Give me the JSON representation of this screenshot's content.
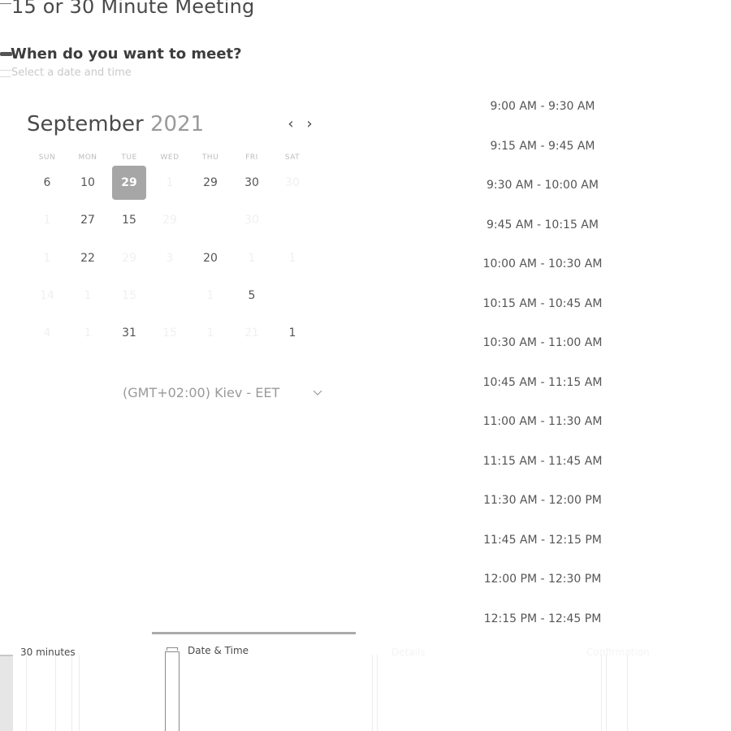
{
  "header": {
    "title": "15 or 30 Minute Meeting",
    "question": "When do you want to meet?",
    "subtitle": "Select a date and time"
  },
  "calendar": {
    "month": "September",
    "year": "2021",
    "prev_icon": "chevron-left-icon",
    "next_icon": "chevron-right-icon",
    "weekdays": [
      "SUN",
      "MON",
      "TUE",
      "WED",
      "THU",
      "FRI",
      "SAT"
    ],
    "selected_day": "29",
    "days": [
      [
        "6",
        "10",
        "29",
        "1",
        "29",
        "30",
        "30"
      ],
      [
        "1",
        "27",
        "15",
        "29",
        "",
        "30",
        ""
      ],
      [
        "1",
        "22",
        "29",
        "3",
        "20",
        "1",
        "1"
      ],
      [
        "14",
        "1",
        "15",
        "",
        "1",
        "5",
        ""
      ],
      [
        "4",
        "1",
        "31",
        "15",
        "1",
        "21",
        "1"
      ]
    ]
  },
  "timezone": {
    "label": "(GMT+02:00) Kiev - EET",
    "dropdown_icon": "chevron-down-icon"
  },
  "time_slots": [
    "9:00 AM - 9:30 AM",
    "9:15 AM - 9:45 AM",
    "9:30 AM - 10:00 AM",
    "9:45 AM - 10:15 AM",
    "10:00 AM - 10:30 AM",
    "10:15 AM - 10:45 AM",
    "10:30 AM - 11:00 AM",
    "10:45 AM - 11:15 AM",
    "11:00 AM - 11:30 AM",
    "11:15 AM - 11:45 AM",
    "11:30 AM - 12:00 PM",
    "11:45 AM - 12:15 PM",
    "12:00 PM - 12:30 PM",
    "12:15 PM - 12:45 PM"
  ],
  "tabs": {
    "duration_label": "30 minutes",
    "datetime_label": "Date & Time",
    "details_label": "Details",
    "confirm_label": "Confirmation"
  }
}
